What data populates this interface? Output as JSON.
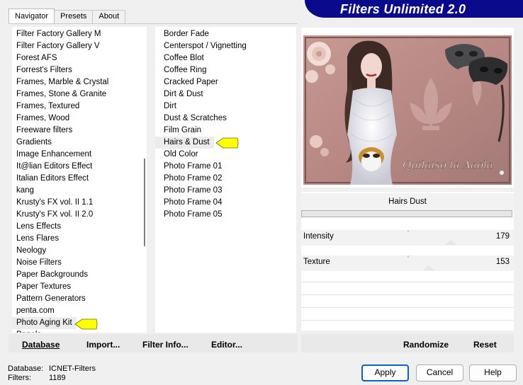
{
  "app": {
    "title": "Filters Unlimited 2.0"
  },
  "tabs": [
    {
      "label": "Navigator"
    },
    {
      "label": "Presets"
    },
    {
      "label": "About"
    }
  ],
  "categories": [
    "Filter Factory Gallery M",
    "Filter Factory Gallery V",
    "Forest AFS",
    "Forrest's Filters",
    "Frames, Marble & Crystal",
    "Frames, Stone & Granite",
    "Frames, Textured",
    "Frames, Wood",
    "Freeware filters",
    "Gradients",
    "Image Enhancement",
    "It@lian Editors Effect",
    "Italian Editors Effect",
    "kang",
    "Krusty's FX vol. II 1.1",
    "Krusty's FX vol. II 2.0",
    "Lens Effects",
    "Lens Flares",
    "Neology",
    "Noise Filters",
    "Paper Backgrounds",
    "Paper Textures",
    "Pattern Generators",
    "penta.com",
    "Photo Aging Kit",
    "Panels"
  ],
  "selected_category": "Photo Aging Kit",
  "filters": [
    "Border Fade",
    "Centerspot / Vignetting",
    "Coffee Blot",
    "Coffee Ring",
    "Cracked Paper",
    "Dirt & Dust",
    "Dirt",
    "Dust & Scratches",
    "Film Grain",
    "Hairs & Dust",
    "Old Color",
    "Photo Frame 01",
    "Photo Frame 02",
    "Photo Frame 03",
    "Photo Frame 04",
    "Photo Frame 05"
  ],
  "selected_filter": "Hairs & Dust",
  "preview": {
    "signature": "Quilaiso la Aaola"
  },
  "filter_panel": {
    "name": "Hairs  Dust",
    "params": [
      {
        "label": "Intensity",
        "value": "179",
        "level": 179
      },
      {
        "label": "Texture",
        "value": "153",
        "level": 153
      }
    ]
  },
  "panel_buttons": {
    "database": "Database",
    "import": "Import...",
    "filter_info": "Filter Info...",
    "editor": "Editor...",
    "randomize": "Randomize",
    "reset": "Reset"
  },
  "status": {
    "database_label": "Database:",
    "database_value": "ICNET-Filters",
    "filters_label": "Filters:",
    "filters_value": "1189"
  },
  "dialog_buttons": {
    "apply": "Apply",
    "cancel": "Cancel",
    "help": "Help"
  },
  "colors": {
    "banner": "#0a0a8c",
    "arrow": "#ffff00",
    "default_button_border": "#0b63c4"
  }
}
